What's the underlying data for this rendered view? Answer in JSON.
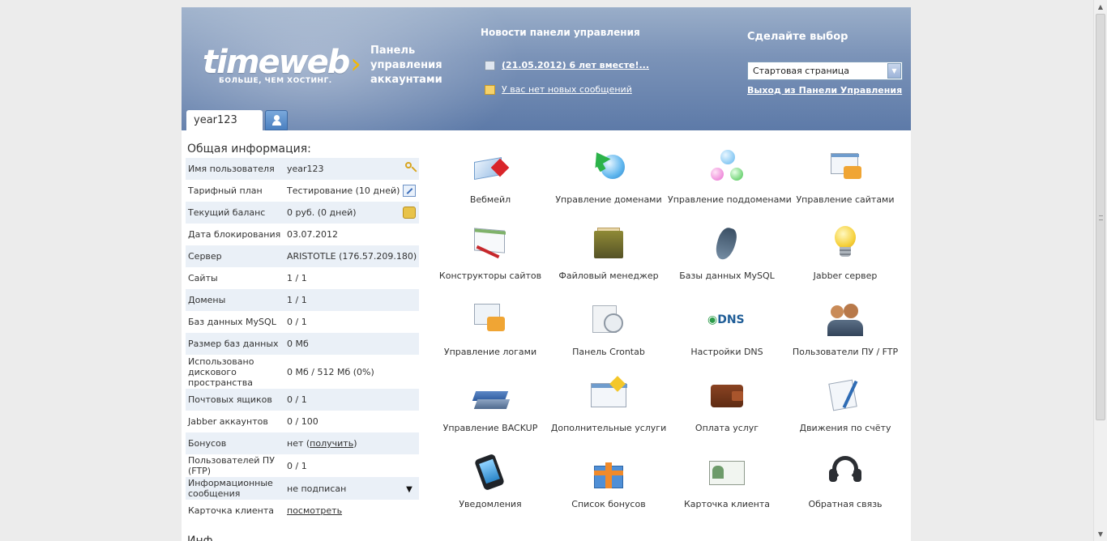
{
  "header": {
    "logo_text": "timeweb",
    "logo_tagline": "БОЛЬШЕ, ЧЕМ ХОСТИНГ.",
    "panel_title": "Панель управления аккаунтами",
    "news_title": "Новости панели управления",
    "news": [
      {
        "text": "(21.05.2012) 6 лет вместе!..."
      },
      {
        "text": "У вас нет новых сообщений"
      }
    ],
    "choice_title": "Сделайте выбор",
    "select_value": "Стартовая страница",
    "exit_link": "Выход из Панели Управления",
    "account_tab": "year123"
  },
  "info": {
    "title": "Общая информация:",
    "rows": [
      {
        "label": "Имя пользователя",
        "value": "year123"
      },
      {
        "label": "Тарифный план",
        "value": "Тестирование (10 дней)"
      },
      {
        "label": "Текущий баланс",
        "value": "0 руб. (0 дней)"
      },
      {
        "label": "Дата блокирования",
        "value": "03.07.2012"
      },
      {
        "label": "Сервер",
        "value": "ARISTOTLE (176.57.209.180)"
      },
      {
        "label": "Сайты",
        "value": "1 / 1"
      },
      {
        "label": "Домены",
        "value": "1 / 1"
      },
      {
        "label": "Баз данных MySQL",
        "value": "0 / 1"
      },
      {
        "label": "Размер баз данных",
        "value": "0 Мб"
      },
      {
        "label": "Использовано дискового пространства",
        "value": "0 Мб / 512 Мб (0%)"
      },
      {
        "label": "Почтовых ящиков",
        "value": "0 / 1"
      },
      {
        "label": "Jabber аккаунтов",
        "value": "0 / 100"
      },
      {
        "label": "Бонусов",
        "value": "нет",
        "link": "получить"
      },
      {
        "label": "Пользователей ПУ (FTP)",
        "value": "0 / 1"
      },
      {
        "label": "Информационные сообщения",
        "value": "не подписан"
      },
      {
        "label": "Карточка клиента",
        "link": "посмотреть"
      }
    ],
    "more_title": "Инф"
  },
  "tiles": [
    {
      "label": "Вебмейл",
      "icon": "webmail-icon"
    },
    {
      "label": "Управление доменами",
      "icon": "domains-icon"
    },
    {
      "label": "Управление поддоменами",
      "icon": "subdomains-icon"
    },
    {
      "label": "Управление сайтами",
      "icon": "sites-icon"
    },
    {
      "label": "Конструкторы сайтов",
      "icon": "site-builder-icon"
    },
    {
      "label": "Файловый менеджер",
      "icon": "file-manager-icon"
    },
    {
      "label": "Базы данных MySQL",
      "icon": "mysql-icon"
    },
    {
      "label": "Jabber сервер",
      "icon": "jabber-icon"
    },
    {
      "label": "Управление логами",
      "icon": "logs-icon"
    },
    {
      "label": "Панель Crontab",
      "icon": "crontab-icon"
    },
    {
      "label": "Настройки DNS",
      "icon": "dns-icon"
    },
    {
      "label": "Пользователи ПУ / FTP",
      "icon": "ftp-users-icon"
    },
    {
      "label": "Управление BACKUP",
      "icon": "backup-icon"
    },
    {
      "label": "Дополнительные услуги",
      "icon": "extra-services-icon"
    },
    {
      "label": "Оплата услуг",
      "icon": "payment-icon"
    },
    {
      "label": "Движения по счёту",
      "icon": "account-movements-icon"
    },
    {
      "label": "Уведомления",
      "icon": "notifications-icon"
    },
    {
      "label": "Список бонусов",
      "icon": "bonuses-icon"
    },
    {
      "label": "Карточка клиента",
      "icon": "client-card-icon"
    },
    {
      "label": "Обратная связь",
      "icon": "feedback-icon"
    }
  ]
}
